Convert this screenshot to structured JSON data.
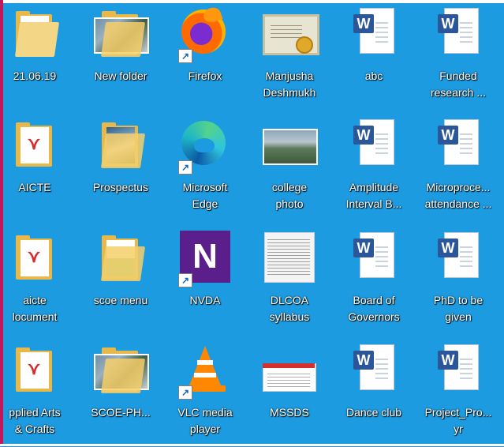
{
  "desktop": {
    "icons": [
      {
        "label": "21.06.19",
        "icon": "folder-icon"
      },
      {
        "label": "New folder",
        "icon": "folder-icon"
      },
      {
        "label": "Firefox",
        "icon": "firefox-icon"
      },
      {
        "label": "Manjusha\nDeshmukh",
        "icon": "certificate-image-icon"
      },
      {
        "label": "abc",
        "icon": "word-document-icon"
      },
      {
        "label": "Funded\nresearch ...",
        "icon": "word-document-icon"
      },
      {
        "label": "AICTE",
        "icon": "pdf-folder-icon"
      },
      {
        "label": "Prospectus",
        "icon": "folder-icon"
      },
      {
        "label": "Microsoft\nEdge",
        "icon": "edge-icon"
      },
      {
        "label": "college\nphoto",
        "icon": "photo-icon"
      },
      {
        "label": "Amplitude\nInterval B...",
        "icon": "word-document-icon"
      },
      {
        "label": "Microproce...\nattendance ...",
        "icon": "word-document-icon"
      },
      {
        "label": "aicte\nlocument",
        "icon": "pdf-folder-icon"
      },
      {
        "label": "scoe menu",
        "icon": "folder-icon"
      },
      {
        "label": "NVDA",
        "icon": "nvda-icon"
      },
      {
        "label": "DLCOA\nsyllabus",
        "icon": "scanned-document-icon"
      },
      {
        "label": "Board of\nGovernors",
        "icon": "word-document-icon"
      },
      {
        "label": "PhD to be\ngiven",
        "icon": "word-document-icon"
      },
      {
        "label": "pplied Arts\n& Crafts",
        "icon": "pdf-folder-icon"
      },
      {
        "label": "SCOE-PH...",
        "icon": "folder-icon"
      },
      {
        "label": "VLC media\nplayer",
        "icon": "vlc-icon"
      },
      {
        "label": "MSSDS",
        "icon": "document-image-icon"
      },
      {
        "label": "Dance club",
        "icon": "word-document-icon"
      },
      {
        "label": "Project_Pro...\nyr",
        "icon": "word-document-icon"
      }
    ]
  }
}
